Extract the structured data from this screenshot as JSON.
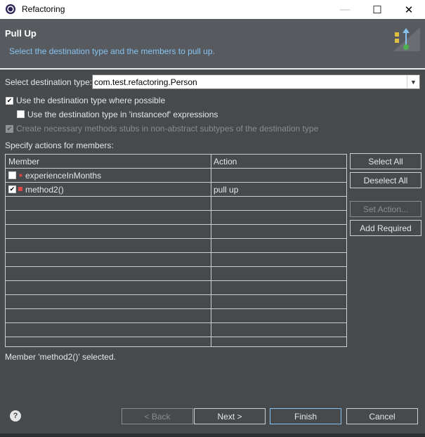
{
  "window": {
    "title": "Refactoring",
    "minimize_icon": "—",
    "maximize_icon": "☐",
    "close_icon": "✕"
  },
  "header": {
    "title": "Pull Up",
    "description": "Select the destination type and the members to pull up."
  },
  "destination": {
    "label": "Select destination type:",
    "value": "com.test.refactoring.Person"
  },
  "options": {
    "use_destination": {
      "label": "Use the destination type where possible",
      "checked": true
    },
    "use_instanceof": {
      "label": "Use the destination type in 'instanceof' expressions",
      "checked": false
    },
    "create_stubs": {
      "label": "Create necessary methods stubs in non-abstract subtypes of the destination type",
      "checked": true,
      "enabled": false
    }
  },
  "members": {
    "label": "Specify actions for members:",
    "columns": [
      "Member",
      "Action"
    ],
    "rows": [
      {
        "name": "experienceInMonths",
        "action": "",
        "checked": false,
        "kind": "field"
      },
      {
        "name": "method2()",
        "action": "pull up",
        "checked": true,
        "kind": "method"
      }
    ]
  },
  "side_buttons": {
    "select_all": "Select All",
    "deselect_all": "Deselect All",
    "set_action": "Set Action...",
    "add_required": "Add Required"
  },
  "status": "Member 'method2()' selected.",
  "footer": {
    "help_icon": "?",
    "back": "< Back",
    "next": "Next >",
    "finish": "Finish",
    "cancel": "Cancel"
  }
}
